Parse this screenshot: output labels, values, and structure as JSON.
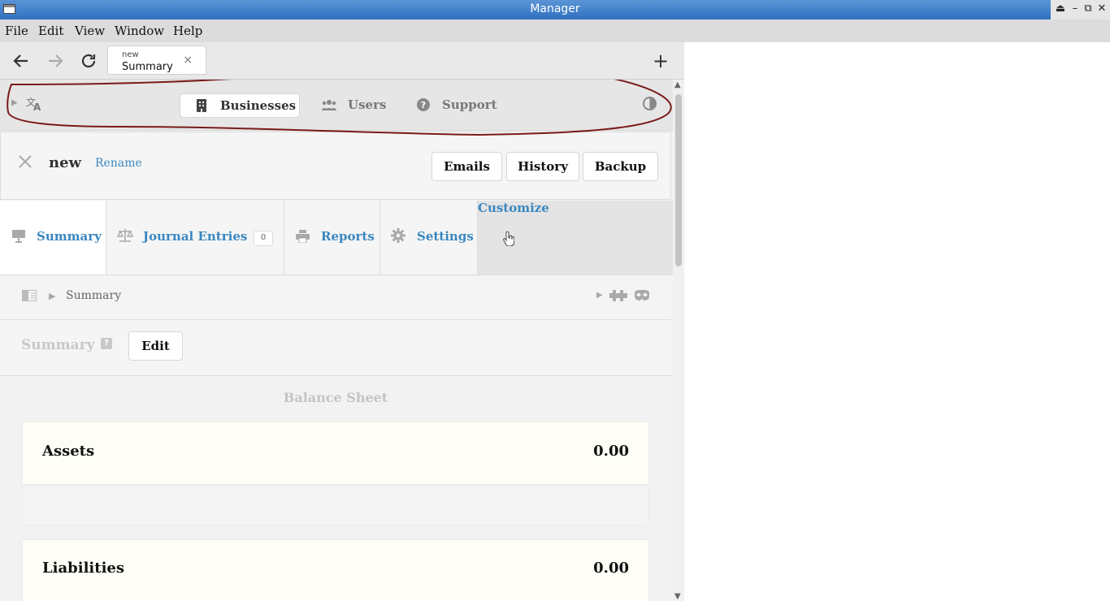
{
  "window": {
    "title": "Manager"
  },
  "menu": [
    "File",
    "Edit",
    "View",
    "Window",
    "Help"
  ],
  "browser": {
    "tab": {
      "subtitle": "new",
      "title": "Summary",
      "close": "×"
    },
    "plus": "+"
  },
  "appnav": {
    "businesses": "Businesses",
    "users": "Users",
    "support": "Support"
  },
  "business": {
    "name": "new",
    "rename": "Rename",
    "buttons": {
      "emails": "Emails",
      "history": "History",
      "backup": "Backup"
    }
  },
  "tabs": {
    "summary": "Summary",
    "journal": "Journal Entries",
    "journal_count": "0",
    "reports": "Reports",
    "settings": "Settings",
    "customize": "Customize"
  },
  "breadcrumb": {
    "current": "Summary"
  },
  "summary": {
    "title": "Summary",
    "help": "?",
    "edit": "Edit"
  },
  "balance_sheet": {
    "heading": "Balance Sheet",
    "assets": {
      "label": "Assets",
      "value": "0.00"
    },
    "liabilities": {
      "label": "Liabilities",
      "value": "0.00"
    }
  },
  "colors": {
    "accent": "#3a87c0",
    "annotation": "#7a1a1a",
    "titlebar": "#3a7fcf"
  }
}
